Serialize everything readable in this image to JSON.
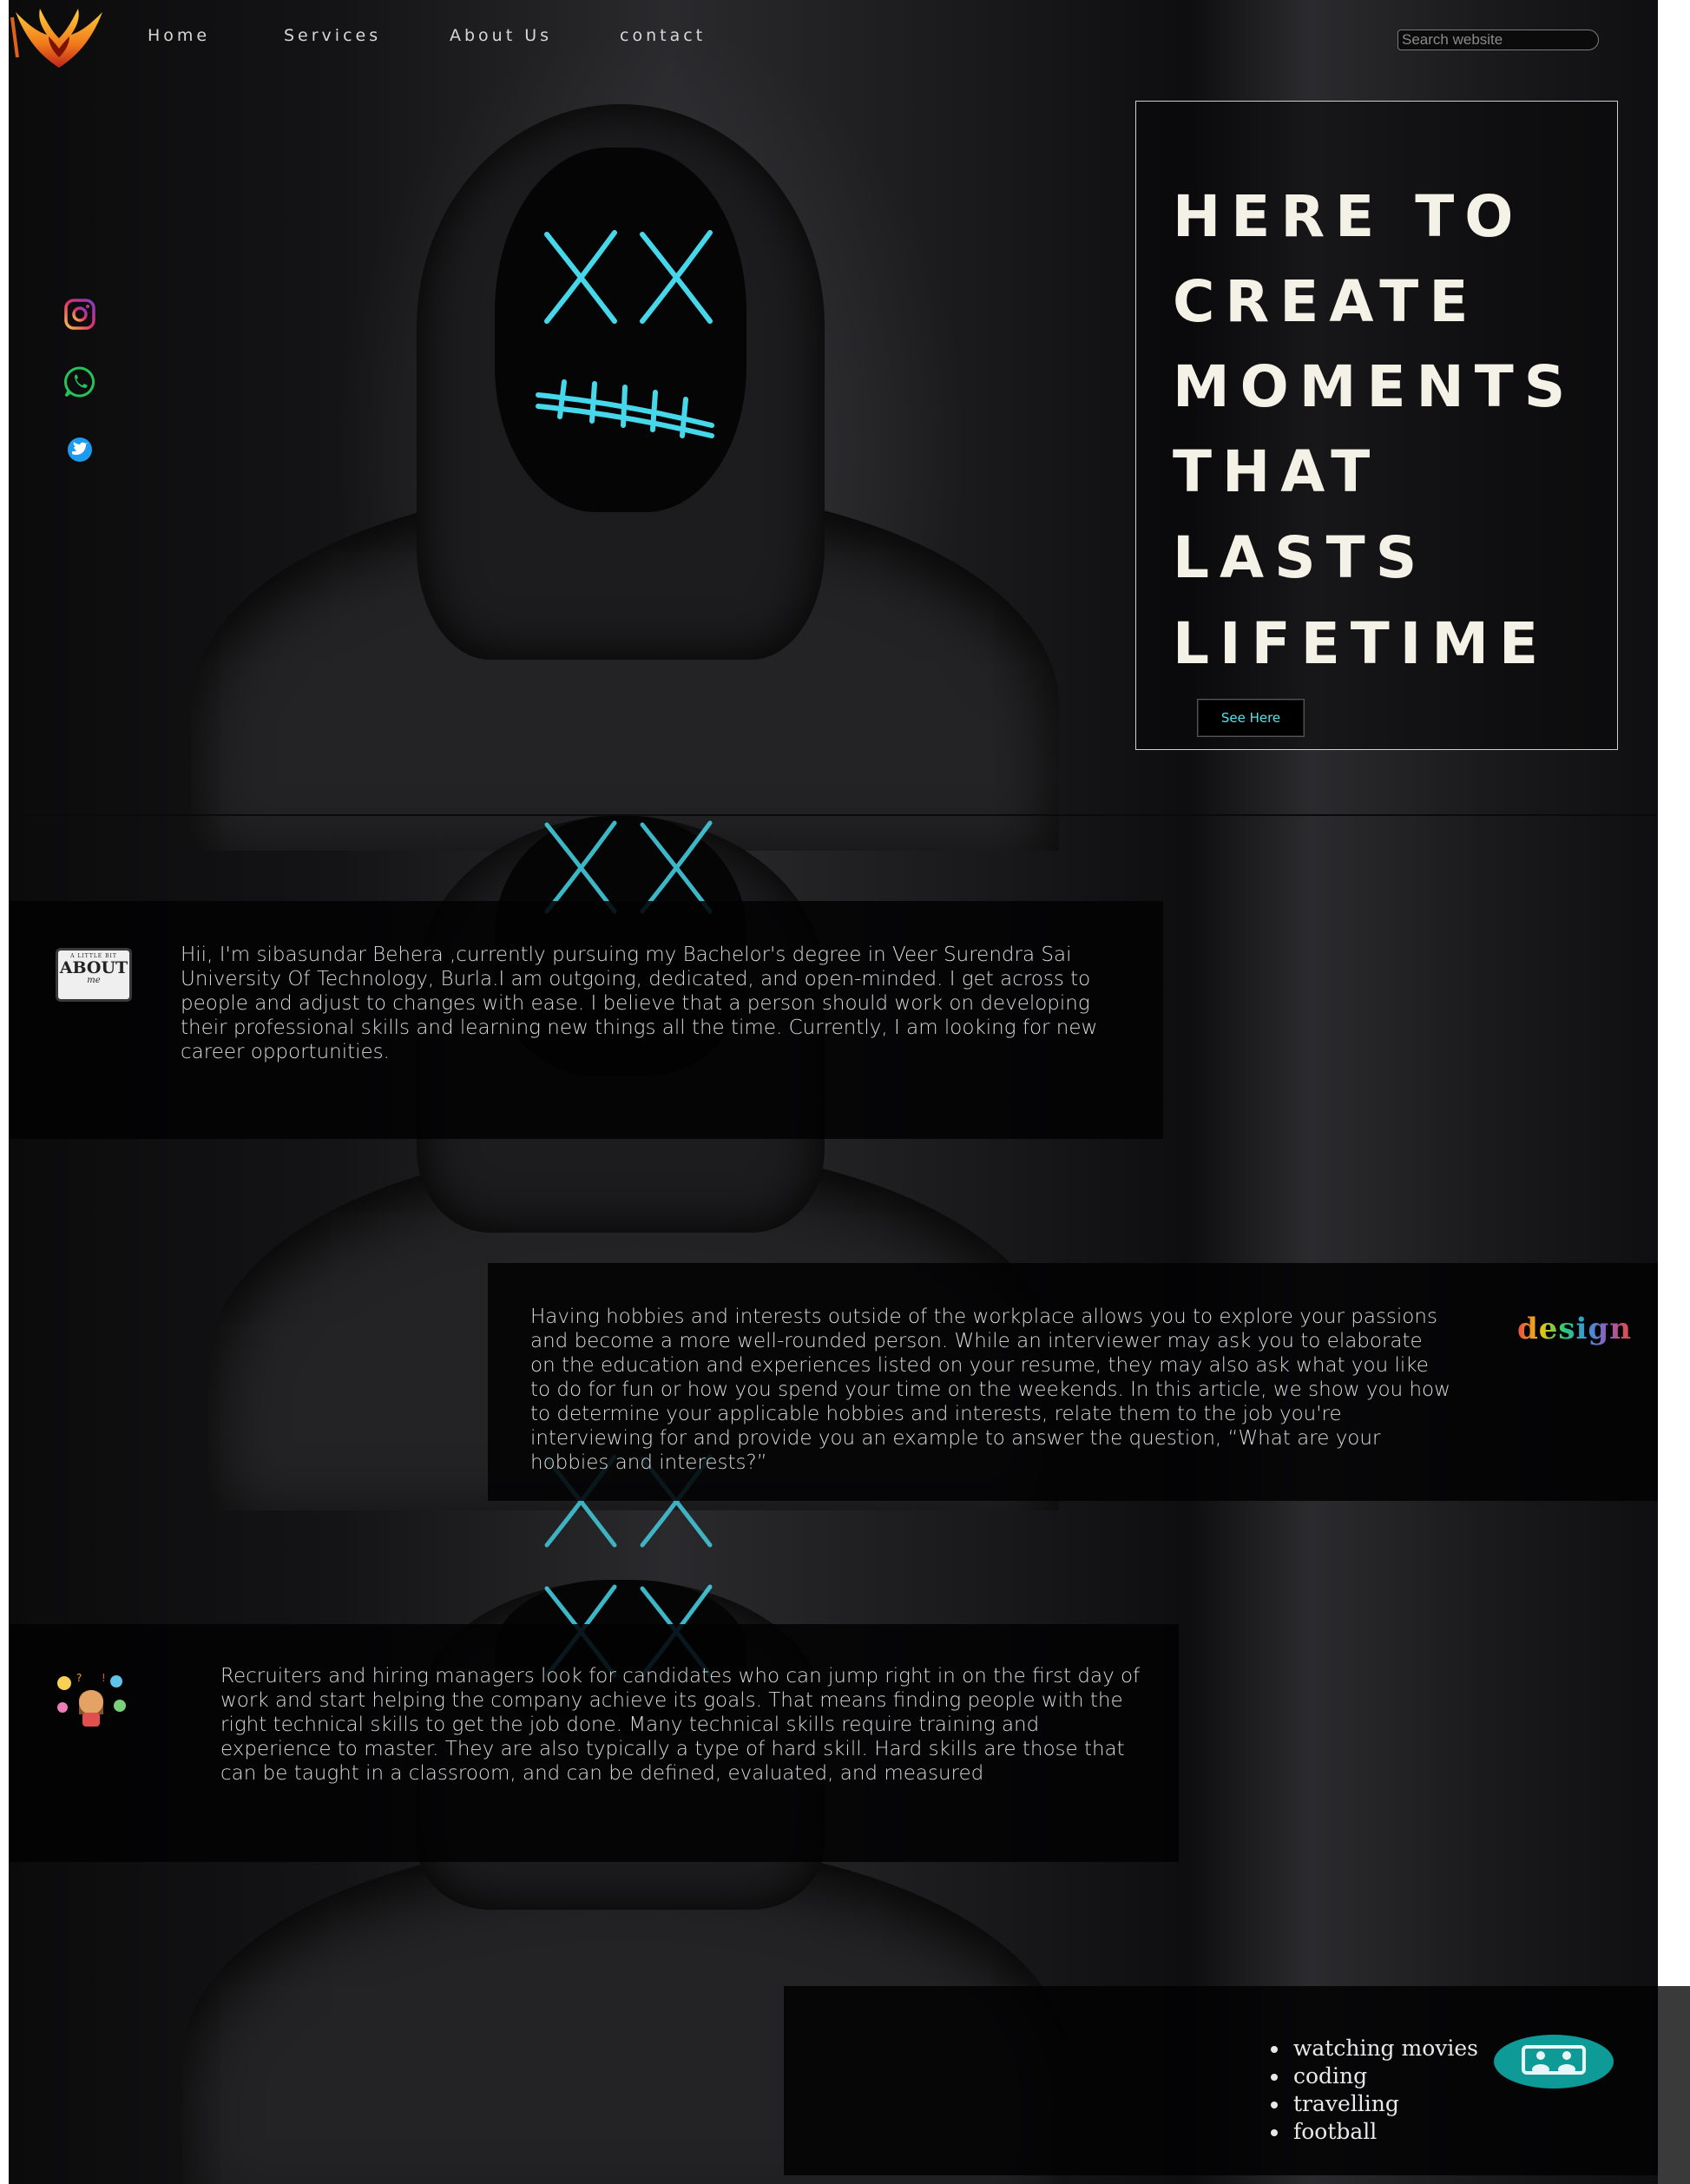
{
  "nav": {
    "items": [
      "Home",
      "Services",
      "About Us",
      "contact"
    ],
    "search_placeholder": "Search website"
  },
  "social": [
    "instagram-icon",
    "whatsapp-icon",
    "twitter-icon"
  ],
  "hero": {
    "lines": [
      "HERE TO",
      "CREATE",
      "MOMENTS",
      "THAT",
      "LASTS",
      "LIFETIME"
    ],
    "button": "See Here"
  },
  "about": {
    "badge": [
      "A LITTLE BIT",
      "ABOUT",
      "me"
    ],
    "text": "Hii, I'm sibasundar Behera ,currently pursuing my Bachelor's degree in Veer Surendra Sai University Of Technology, Burla.I am outgoing, dedicated, and open-minded. I get across to people and adjust to changes with ease. I believe that a person should work on developing their professional skills and learning new things all the time. Currently, I am looking for new career opportunities."
  },
  "interests": {
    "text": "Having hobbies and interests outside of the workplace allows you to explore your passions and become a more well-rounded person. While an interviewer may ask you to elaborate on the education and experiences listed on your resume, they may also ask what you like to do for fun or how you spend your time on the weekends. In this article, we show you how to determine your applicable hobbies and interests, relate them to the job you're interviewing for and provide you an example to answer the question, “What are your hobbies and interests?”",
    "sticker": "design"
  },
  "skills": {
    "text": "Recruiters and hiring managers look for candidates who can jump right in on the first day of work and start helping the company achieve its goals. That means finding people with the right technical skills to get the job done. Many technical skills require training and experience to master. They are also typically a type of hard skill. Hard skills are those that can be taught in a classroom, and can be defined, evaluated, and measured"
  },
  "hobbies": {
    "items": [
      "watching movies",
      "coding",
      "travelling",
      "football"
    ]
  },
  "colors": {
    "accent_cyan": "#53e4f0",
    "hero_text": "#f4f2e6",
    "teal_badge": "#0e9a96"
  }
}
